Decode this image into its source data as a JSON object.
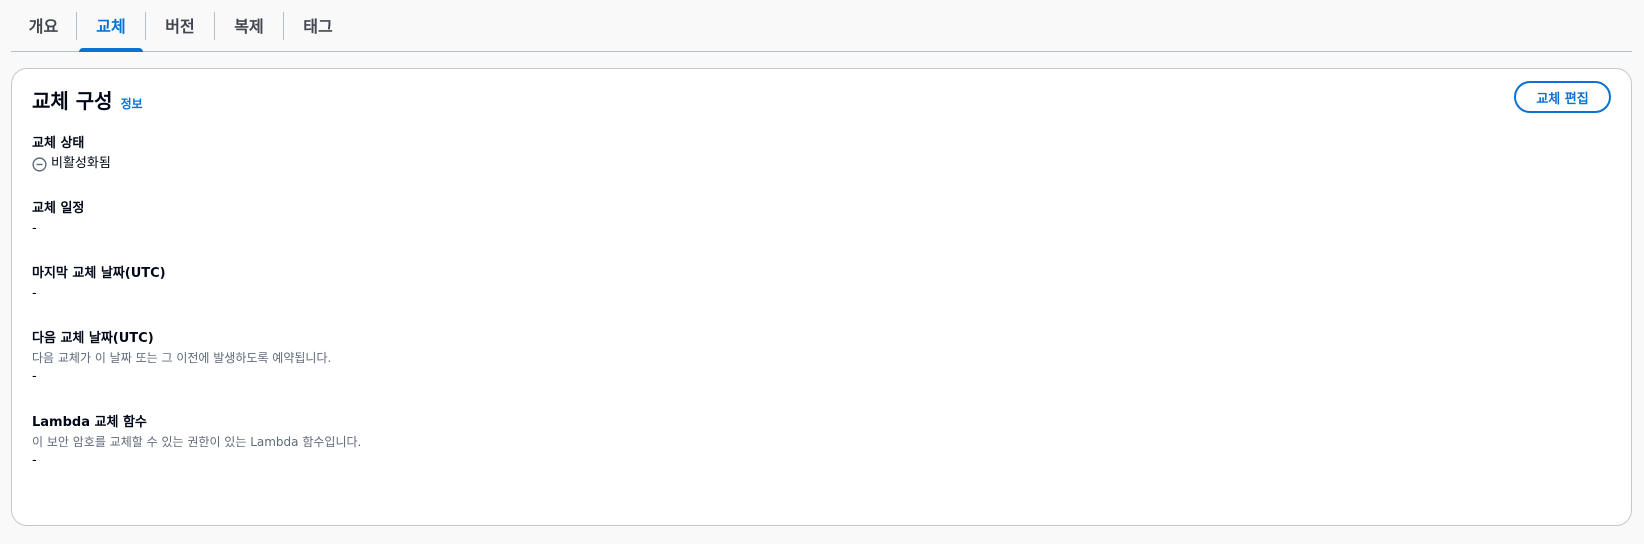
{
  "tabs": [
    {
      "label": "개요",
      "active": false
    },
    {
      "label": "교체",
      "active": true
    },
    {
      "label": "버전",
      "active": false
    },
    {
      "label": "복제",
      "active": false
    },
    {
      "label": "태그",
      "active": false
    }
  ],
  "panel": {
    "title": "교체 구성",
    "info_link": "정보",
    "edit_button": "교체 편집"
  },
  "fields": {
    "rotation_status": {
      "label": "교체 상태",
      "value": "비활성화됨",
      "icon": "status-disabled-icon"
    },
    "rotation_schedule": {
      "label": "교체 일정",
      "value": "-"
    },
    "last_rotated": {
      "label": "마지막 교체 날짜(UTC)",
      "value": "-"
    },
    "next_rotation": {
      "label": "다음 교체 날짜(UTC)",
      "description": "다음 교체가 이 날짜 또는 그 이전에 발생하도록 예약됩니다.",
      "value": "-"
    },
    "lambda_function": {
      "label": "Lambda 교체 함수",
      "description": "이 보안 암호를 교체할 수 있는 권한이 있는 Lambda 함수입니다.",
      "value": "-"
    }
  },
  "colors": {
    "accent": "#0972d3",
    "text": "#000716",
    "muted": "#5f6b7a",
    "border": "#c6c6cd",
    "background": "#f9f9fa"
  }
}
